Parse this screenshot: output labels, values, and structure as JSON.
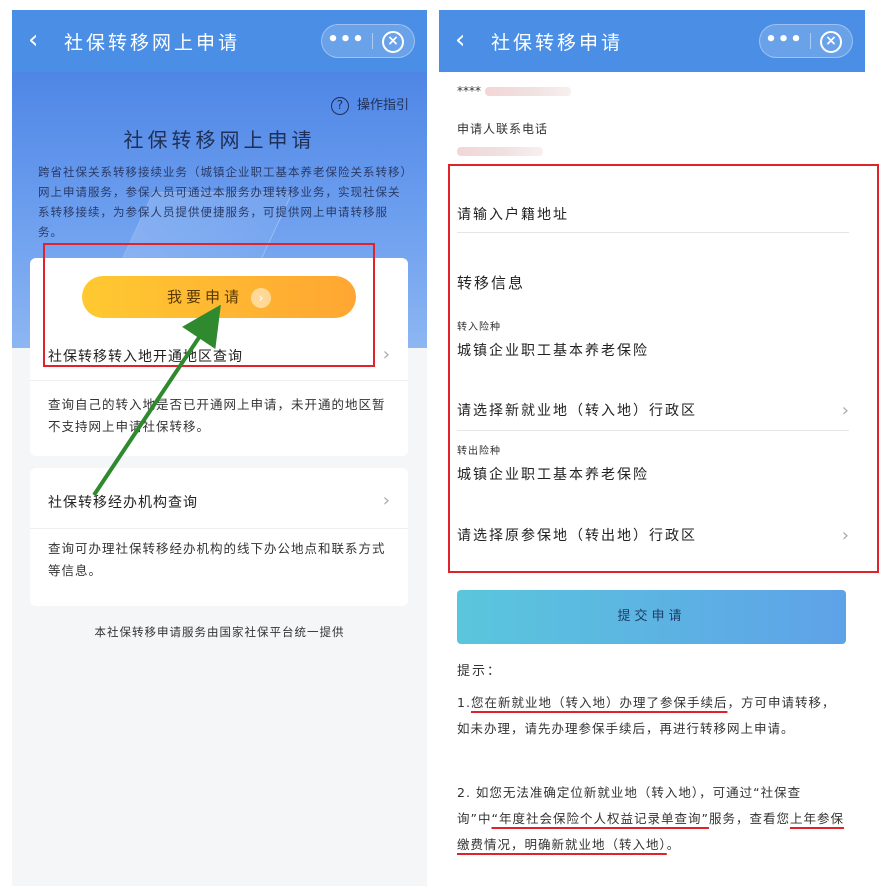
{
  "left": {
    "title": "社保转移网上申请",
    "guide_label": "操作指引",
    "hero_title": "社保转移网上申请",
    "hero_desc": "跨省社保关系转移接续业务（城镇企业职工基本养老保险关系转移）网上申请服务，参保人员可通过本服务办理转移业务，实现社保关系转移接续，为参保人员提供便捷服务，可提供网上申请转移服务。",
    "apply_button": "我要申请",
    "query_region": "社保转移转入地开通地区查询",
    "query_region_desc": "查询自己的转入地是否已开通网上申请，未开通的地区暂不支持网上申请社保转移。",
    "query_agency": "社保转移经办机构查询",
    "query_agency_desc": "查询可办理社保转移经办机构的线下办公地点和联系方式等信息。",
    "footer": "本社保转移申请服务由国家社保平台统一提供"
  },
  "right": {
    "title": "社保转移申请",
    "masked_id": "****",
    "phone_label": "申请人联系电话",
    "address_placeholder": "请输入户籍地址",
    "transfer_section": "转移信息",
    "in_insurance_label": "转入险种",
    "in_insurance_value": "城镇企业职工基本养老保险",
    "in_region_placeholder": "请选择新就业地（转入地）行政区",
    "out_insurance_label": "转出险种",
    "out_insurance_value": "城镇企业职工基本养老保险",
    "out_region_placeholder": "请选择原参保地（转出地）行政区",
    "submit_button": "提交申请",
    "tips_title": "提示：",
    "tip1_a": "1.",
    "tip1_b": "您在新就业地（转入地）办理了参保手续后",
    "tip1_c": "，方可申请转移，如未办理，请先办理参保手续后，再进行转移网上申请。",
    "tip2_a": "2. 如您无法准确定位新就业地（转入地），可通过“社保查询”中",
    "tip2_b": "“年度社会保险个人权益记录单查询”",
    "tip2_c": "服务，查看您",
    "tip2_d": "上年参保缴费情况，明确新就业地（转入地）",
    "tip2_e": "。"
  },
  "capsule": {
    "more": "•••",
    "close": "×"
  },
  "colors": {
    "header_blue": "#4a8ee6",
    "apply_yellow": "#ffb832",
    "highlight_red": "#e0232a",
    "arrow_green": "#2f8a2f"
  }
}
